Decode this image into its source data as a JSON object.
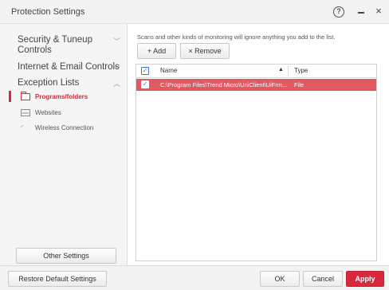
{
  "window": {
    "title": "Protection Settings",
    "help_glyph": "?",
    "close_glyph": "×"
  },
  "sidebar": {
    "categories": [
      {
        "label": "Security & Tuneup Controls",
        "expanded": false
      },
      {
        "label": "Internet & Email Controls",
        "expanded": false
      },
      {
        "label": "Exception Lists",
        "expanded": true
      }
    ],
    "sub_items": [
      {
        "label": "Programs/folders",
        "icon": "folder-icon",
        "active": true
      },
      {
        "label": "Websites",
        "icon": "website-icon",
        "active": false
      },
      {
        "label": "Wireless Connection",
        "icon": "wifi-icon",
        "active": false
      }
    ],
    "other_settings_label": "Other Settings"
  },
  "main": {
    "hint": "Scans and other kinds of monitoring will ignore anything you add to the list.",
    "add_label": "+ Add",
    "remove_label": "× Remove",
    "table": {
      "columns": [
        "Name",
        "Type"
      ],
      "sort_indicator": "▲",
      "rows": [
        {
          "checked": true,
          "name": "C:\\Program Files\\Trend Micro\\UniClient\\UiFrm...",
          "type": "File"
        }
      ]
    }
  },
  "footer": {
    "restore_label": "Restore Default Settings",
    "ok_label": "OK",
    "cancel_label": "Cancel",
    "apply_label": "Apply"
  },
  "colors": {
    "accent": "#d9283c",
    "selected_row": "#e15a62",
    "checkbox": "#3a7bd5"
  }
}
